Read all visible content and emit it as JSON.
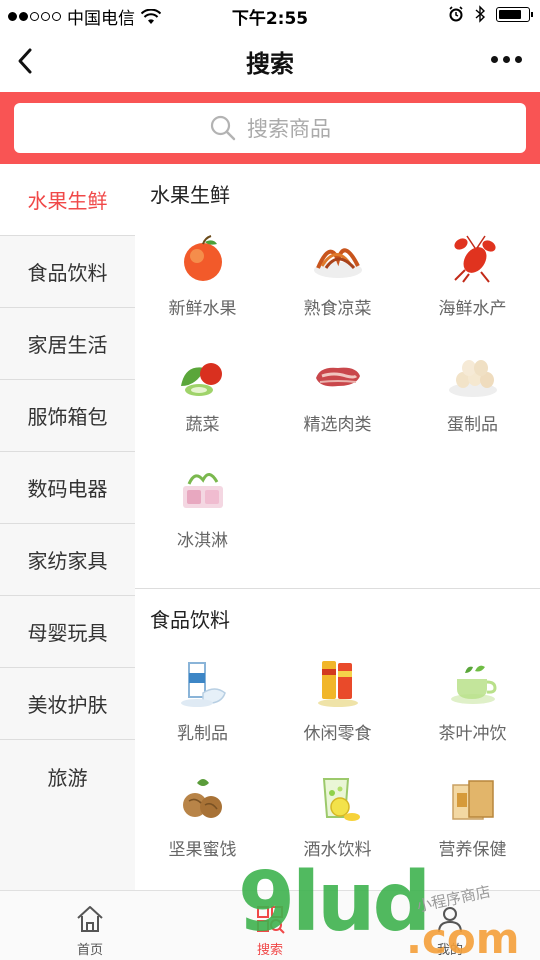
{
  "status_bar": {
    "carrier": "中国电信",
    "time": "下午2:55"
  },
  "nav": {
    "title": "搜索"
  },
  "search": {
    "placeholder": "搜索商品"
  },
  "colors": {
    "accent": "#f95454",
    "active_text": "#f04848"
  },
  "sidebar": {
    "items": [
      {
        "label": "水果生鲜"
      },
      {
        "label": "食品饮料"
      },
      {
        "label": "家居生活"
      },
      {
        "label": "服饰箱包"
      },
      {
        "label": "数码电器"
      },
      {
        "label": "家纺家具"
      },
      {
        "label": "母婴玩具"
      },
      {
        "label": "美妆护肤"
      },
      {
        "label": "旅游"
      }
    ]
  },
  "sections": [
    {
      "title": "水果生鲜",
      "items": [
        {
          "label": "新鲜水果",
          "icon": "apple-icon"
        },
        {
          "label": "熟食凉菜",
          "icon": "cooked-food-icon"
        },
        {
          "label": "海鲜水产",
          "icon": "lobster-icon"
        },
        {
          "label": "蔬菜",
          "icon": "vegetable-icon"
        },
        {
          "label": "精选肉类",
          "icon": "meat-icon"
        },
        {
          "label": "蛋制品",
          "icon": "eggs-icon"
        },
        {
          "label": "冰淇淋",
          "icon": "ice-cream-icon"
        }
      ]
    },
    {
      "title": "食品饮料",
      "items": [
        {
          "label": "乳制品",
          "icon": "milk-icon"
        },
        {
          "label": "休闲零食",
          "icon": "snack-icon"
        },
        {
          "label": "茶叶冲饮",
          "icon": "tea-icon"
        },
        {
          "label": "坚果蜜饯",
          "icon": "walnut-icon"
        },
        {
          "label": "酒水饮料",
          "icon": "drink-icon"
        },
        {
          "label": "营养保健",
          "icon": "health-box-icon"
        }
      ]
    }
  ],
  "tabbar": {
    "items": [
      {
        "label": "首页"
      },
      {
        "label": "搜索"
      },
      {
        "label": "我的"
      }
    ]
  },
  "watermark": {
    "brand": "9lud",
    "domain": ".com",
    "slogan": "小程序商店"
  }
}
